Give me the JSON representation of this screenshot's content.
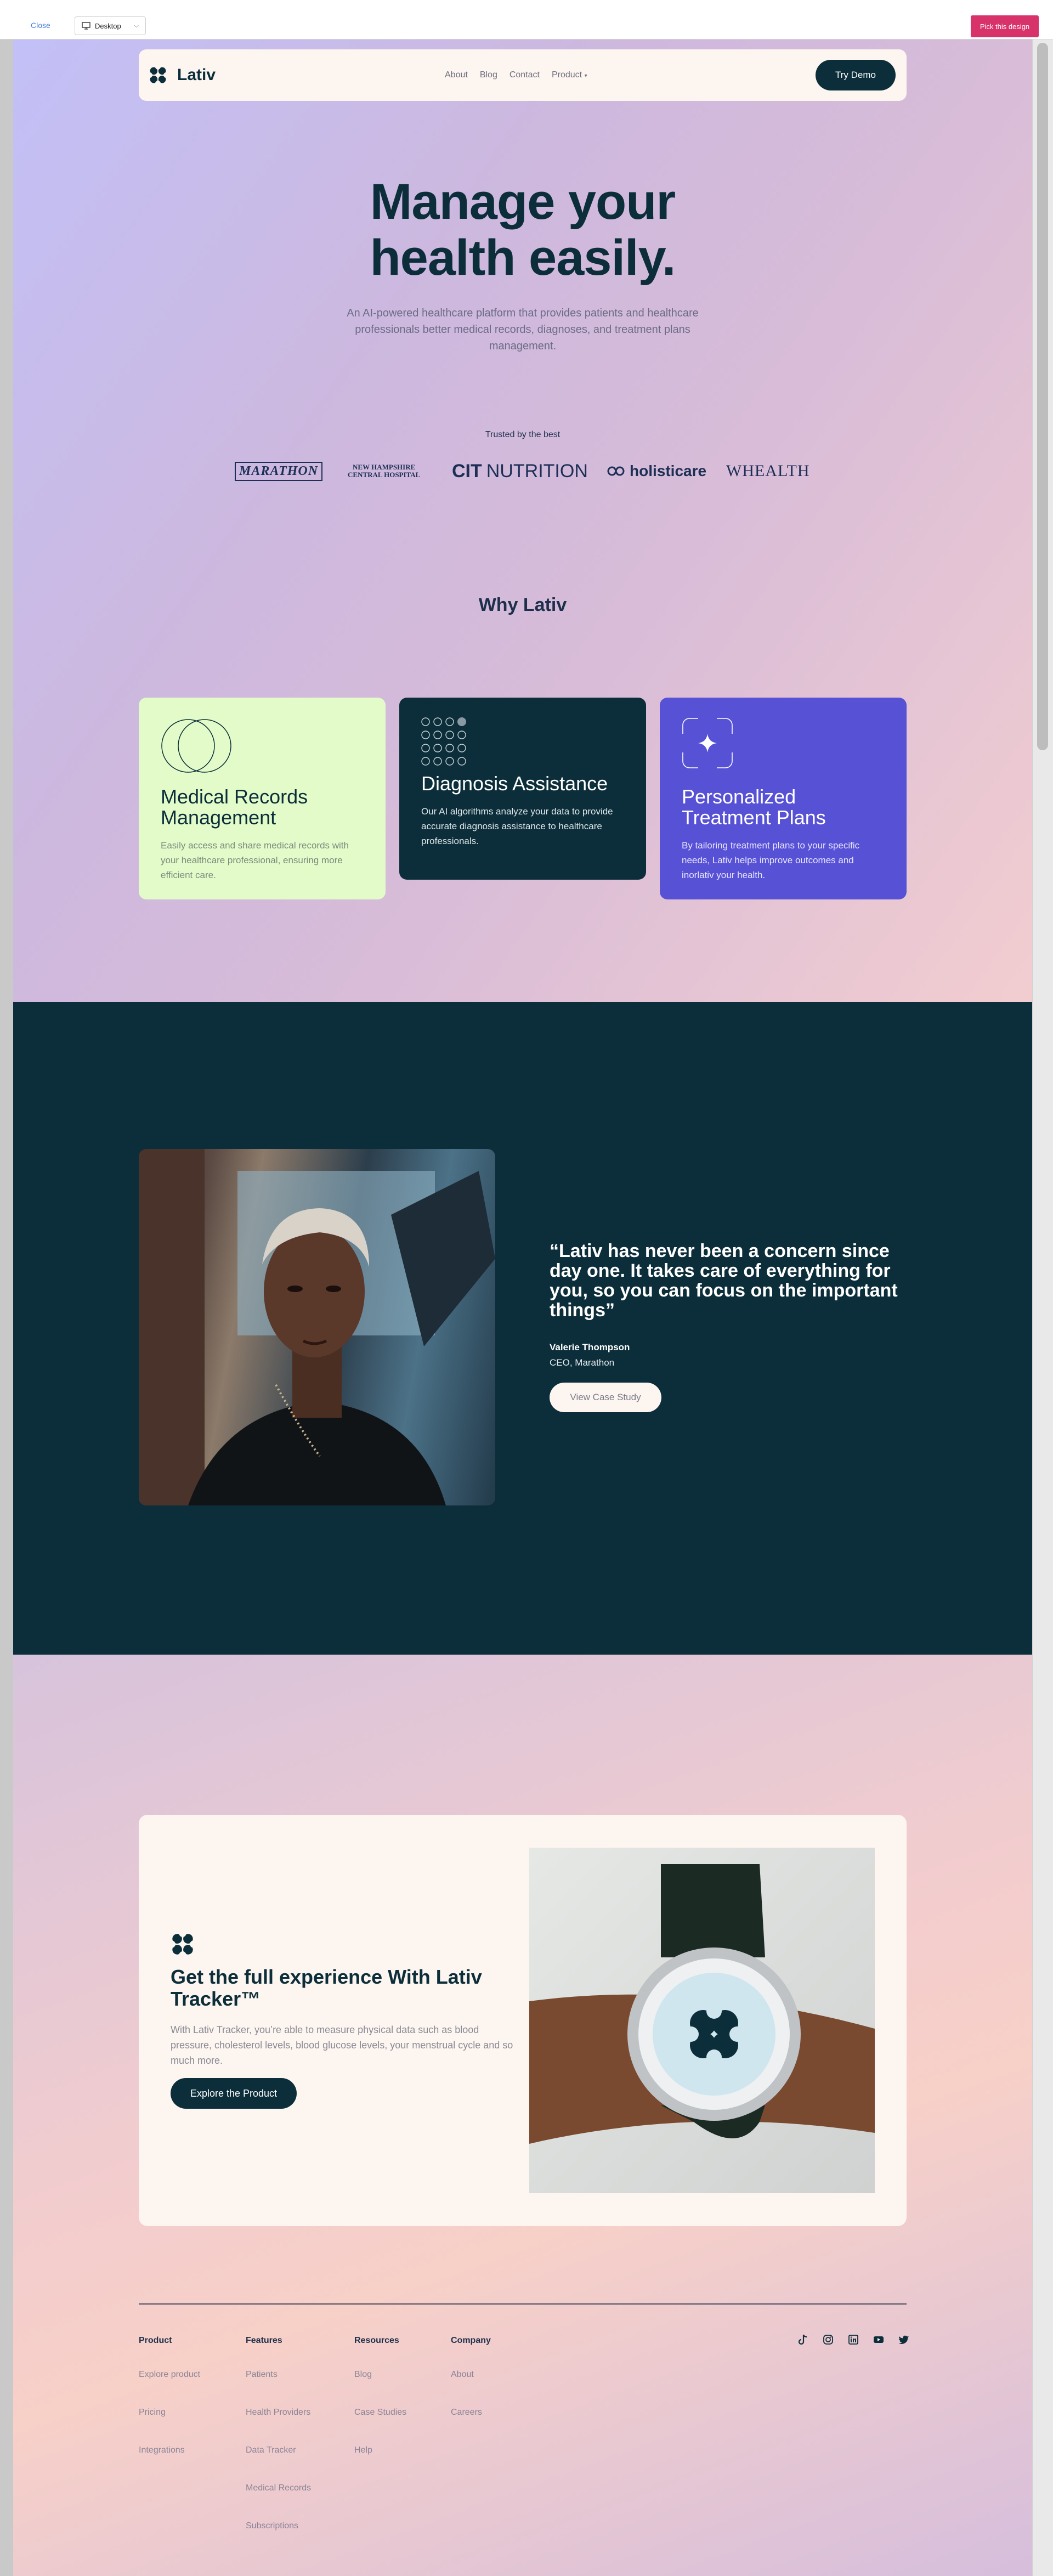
{
  "preview": {
    "close_label": "Close",
    "device_label": "Desktop",
    "pick_label": "Pick this design"
  },
  "nav": {
    "brand": "Lativ",
    "links": [
      "About",
      "Blog",
      "Contact"
    ],
    "product_label": "Product",
    "cta": "Try Demo"
  },
  "hero": {
    "title_line1": "Manage your",
    "title_line2": "health easily.",
    "subtitle": "An AI-powered healthcare platform that provides patients and healthcare professionals better medical records, diagnoses, and treatment plans management."
  },
  "trusted": {
    "label": "Trusted by the best",
    "logos": {
      "marathon": "MARATHON",
      "nh_line1": "NEW HAMPSHIRE",
      "nh_line2": "CENTRAL HOSPITAL",
      "cit_bold": "CIT",
      "cit_rest": "NUTRITION",
      "holisticare": "holisticare",
      "wealth": "WHEALTH"
    }
  },
  "why": {
    "title": "Why Lativ",
    "cards": [
      {
        "title": "Medical Records Management",
        "text": "Easily access and share medical records with your healthcare professional, ensuring more efficient care."
      },
      {
        "title": "Diagnosis Assistance",
        "text": "Our AI algorithms analyze your data to provide accurate diagnosis assistance to healthcare professionals."
      },
      {
        "title": "Personalized Treatment Plans",
        "text": "By tailoring treatment plans to your specific needs, Lativ helps improve outcomes and inorlativ your health."
      }
    ]
  },
  "testimonial": {
    "quote": "“Lativ has never been a concern since day one. It takes care of everything for you, so you can focus on the important things”",
    "name": "Valerie Thompson",
    "role": "CEO, Marathon",
    "cta": "View Case Study"
  },
  "tracker": {
    "title": "Get the full experience With Lativ Tracker™",
    "text": "With Lativ Tracker, you’re able to measure physical data such as blood pressure, cholesterol levels, blood glucose levels, your menstrual cycle and so much more.",
    "cta": "Explore the Product"
  },
  "footer": {
    "columns": [
      {
        "heading": "Product",
        "links": [
          "Explore product",
          "Pricing",
          "Integrations"
        ]
      },
      {
        "heading": "Features",
        "links": [
          "Patients",
          "Health Providers",
          "Data Tracker",
          "Medical Records",
          "Subscriptions"
        ]
      },
      {
        "heading": "Resources",
        "links": [
          "Blog",
          "Case Studies",
          "Help"
        ]
      },
      {
        "heading": "Company",
        "links": [
          "About",
          "Careers"
        ]
      }
    ],
    "social_icons": [
      "tiktok-icon",
      "instagram-icon",
      "linkedin-icon",
      "youtube-icon",
      "twitter-icon"
    ]
  },
  "colors": {
    "brand_dark": "#0c2e3a",
    "card_green": "#e2fbc9",
    "card_purple": "#5751d6",
    "cream": "#fdf5ef",
    "pick_pink": "#d8326b"
  }
}
